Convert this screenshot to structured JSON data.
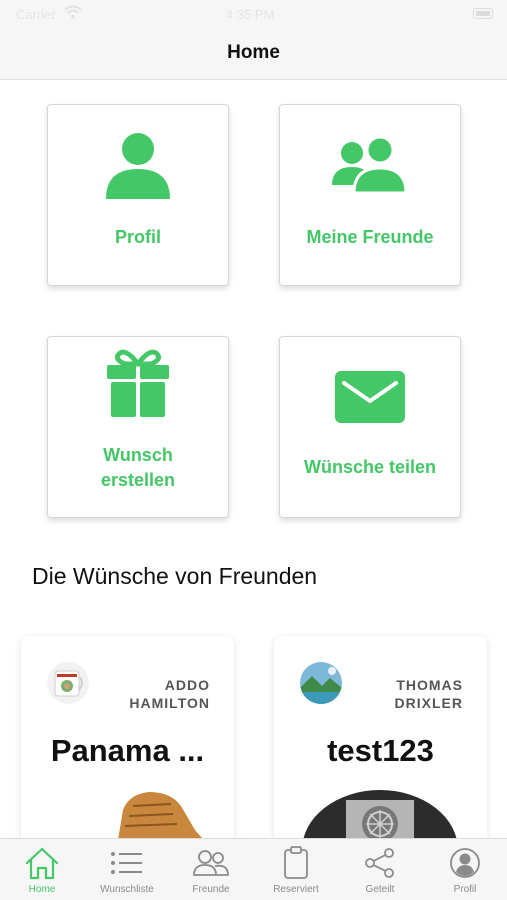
{
  "colors": {
    "accent": "#44c766",
    "tab_inactive": "#8a8a8a",
    "text": "#111111"
  },
  "status_bar": {
    "carrier": "Carrier",
    "time": "4:35 PM"
  },
  "nav": {
    "title": "Home"
  },
  "tiles": [
    {
      "label": "Profil",
      "icon": "person-icon"
    },
    {
      "label": "Meine Freunde",
      "icon": "friends-icon"
    },
    {
      "label_line1": "Wunsch",
      "label_line2": "erstellen",
      "icon": "gift-icon"
    },
    {
      "label": "Wünsche teilen",
      "icon": "envelope-icon"
    }
  ],
  "section": {
    "title": "Die Wünsche von Freunden"
  },
  "wish_cards": [
    {
      "owner_first": "ADDO",
      "owner_last": "HAMILTON",
      "title": "Panama ...",
      "avatar_icon": "mug-avatar-icon",
      "image_icon": "shoe-image-icon"
    },
    {
      "owner_first": "THOMAS",
      "owner_last": "DRIXLER",
      "title": "test123",
      "avatar_icon": "landscape-avatar-icon",
      "image_icon": "fan-image-icon"
    }
  ],
  "tab_bar": {
    "items": [
      {
        "label": "Home",
        "icon": "home-icon",
        "active": true
      },
      {
        "label": "Wunschliste",
        "icon": "list-icon",
        "active": false
      },
      {
        "label": "Freunde",
        "icon": "friends-icon",
        "active": false
      },
      {
        "label": "Reserviert",
        "icon": "clipboard-icon",
        "active": false
      },
      {
        "label": "Geteilt",
        "icon": "share-icon",
        "active": false
      },
      {
        "label": "Profil",
        "icon": "profile-icon",
        "active": false
      }
    ]
  }
}
